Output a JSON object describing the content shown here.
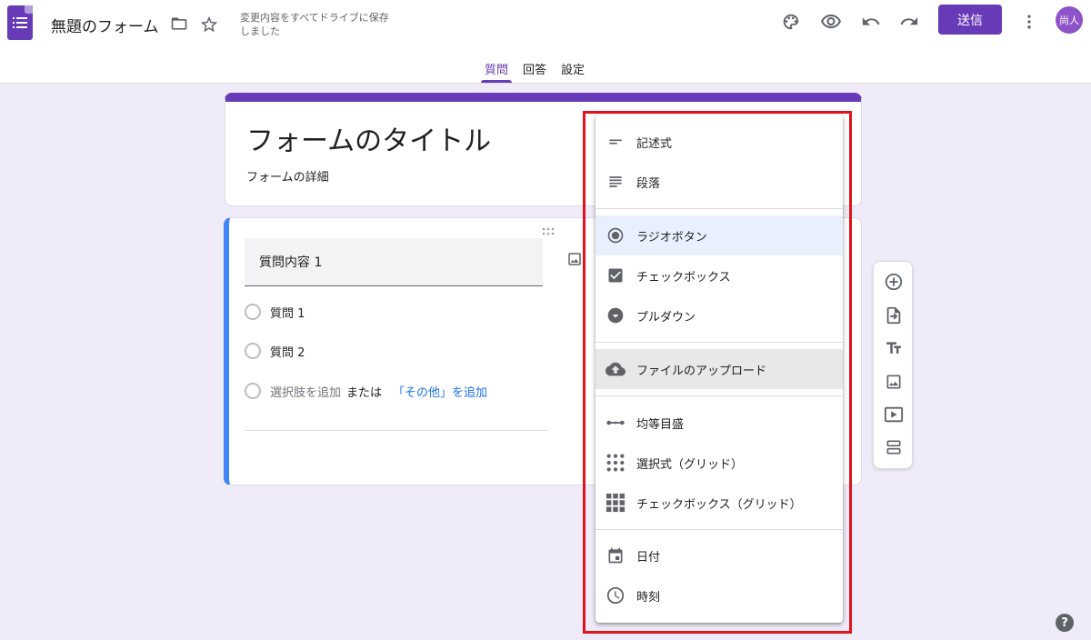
{
  "header": {
    "doc_title": "無題のフォーム",
    "save_status": "変更内容をすべてドライブに保存しました",
    "send_label": "送信",
    "avatar_text": "尚人",
    "help_label": "?"
  },
  "tabs": [
    {
      "label": "質問",
      "active": true
    },
    {
      "label": "回答",
      "active": false
    },
    {
      "label": "設定",
      "active": false
    }
  ],
  "form": {
    "title": "フォームのタイトル",
    "description": "フォームの詳細"
  },
  "question": {
    "title": "質問内容 1",
    "options": [
      "質問 1",
      "質問 2"
    ],
    "add_option": "選択肢を追加",
    "or_text": "または",
    "add_other": "「その他」を追加"
  },
  "menu": {
    "items": [
      {
        "label": "記述式",
        "icon": "short-text-icon"
      },
      {
        "label": "段落",
        "icon": "paragraph-icon"
      },
      {
        "label": "ラジオボタン",
        "icon": "radio-button-icon",
        "selected": true
      },
      {
        "label": "チェックボックス",
        "icon": "checkbox-icon"
      },
      {
        "label": "プルダウン",
        "icon": "dropdown-icon"
      },
      {
        "label": "ファイルのアップロード",
        "icon": "cloud-upload-icon",
        "hovered": true
      },
      {
        "label": "均等目盛",
        "icon": "linear-scale-icon"
      },
      {
        "label": "選択式（グリッド）",
        "icon": "dots-grid-icon"
      },
      {
        "label": "チェックボックス（グリッド）",
        "icon": "checkbox-grid-icon"
      },
      {
        "label": "日付",
        "icon": "calendar-icon"
      },
      {
        "label": "時刻",
        "icon": "clock-icon"
      }
    ]
  },
  "colors": {
    "accent": "#673ab7",
    "background": "#f0ebf8",
    "highlight_border": "#e0121c",
    "link": "#1a73e8",
    "question_accent": "#4285f4"
  }
}
